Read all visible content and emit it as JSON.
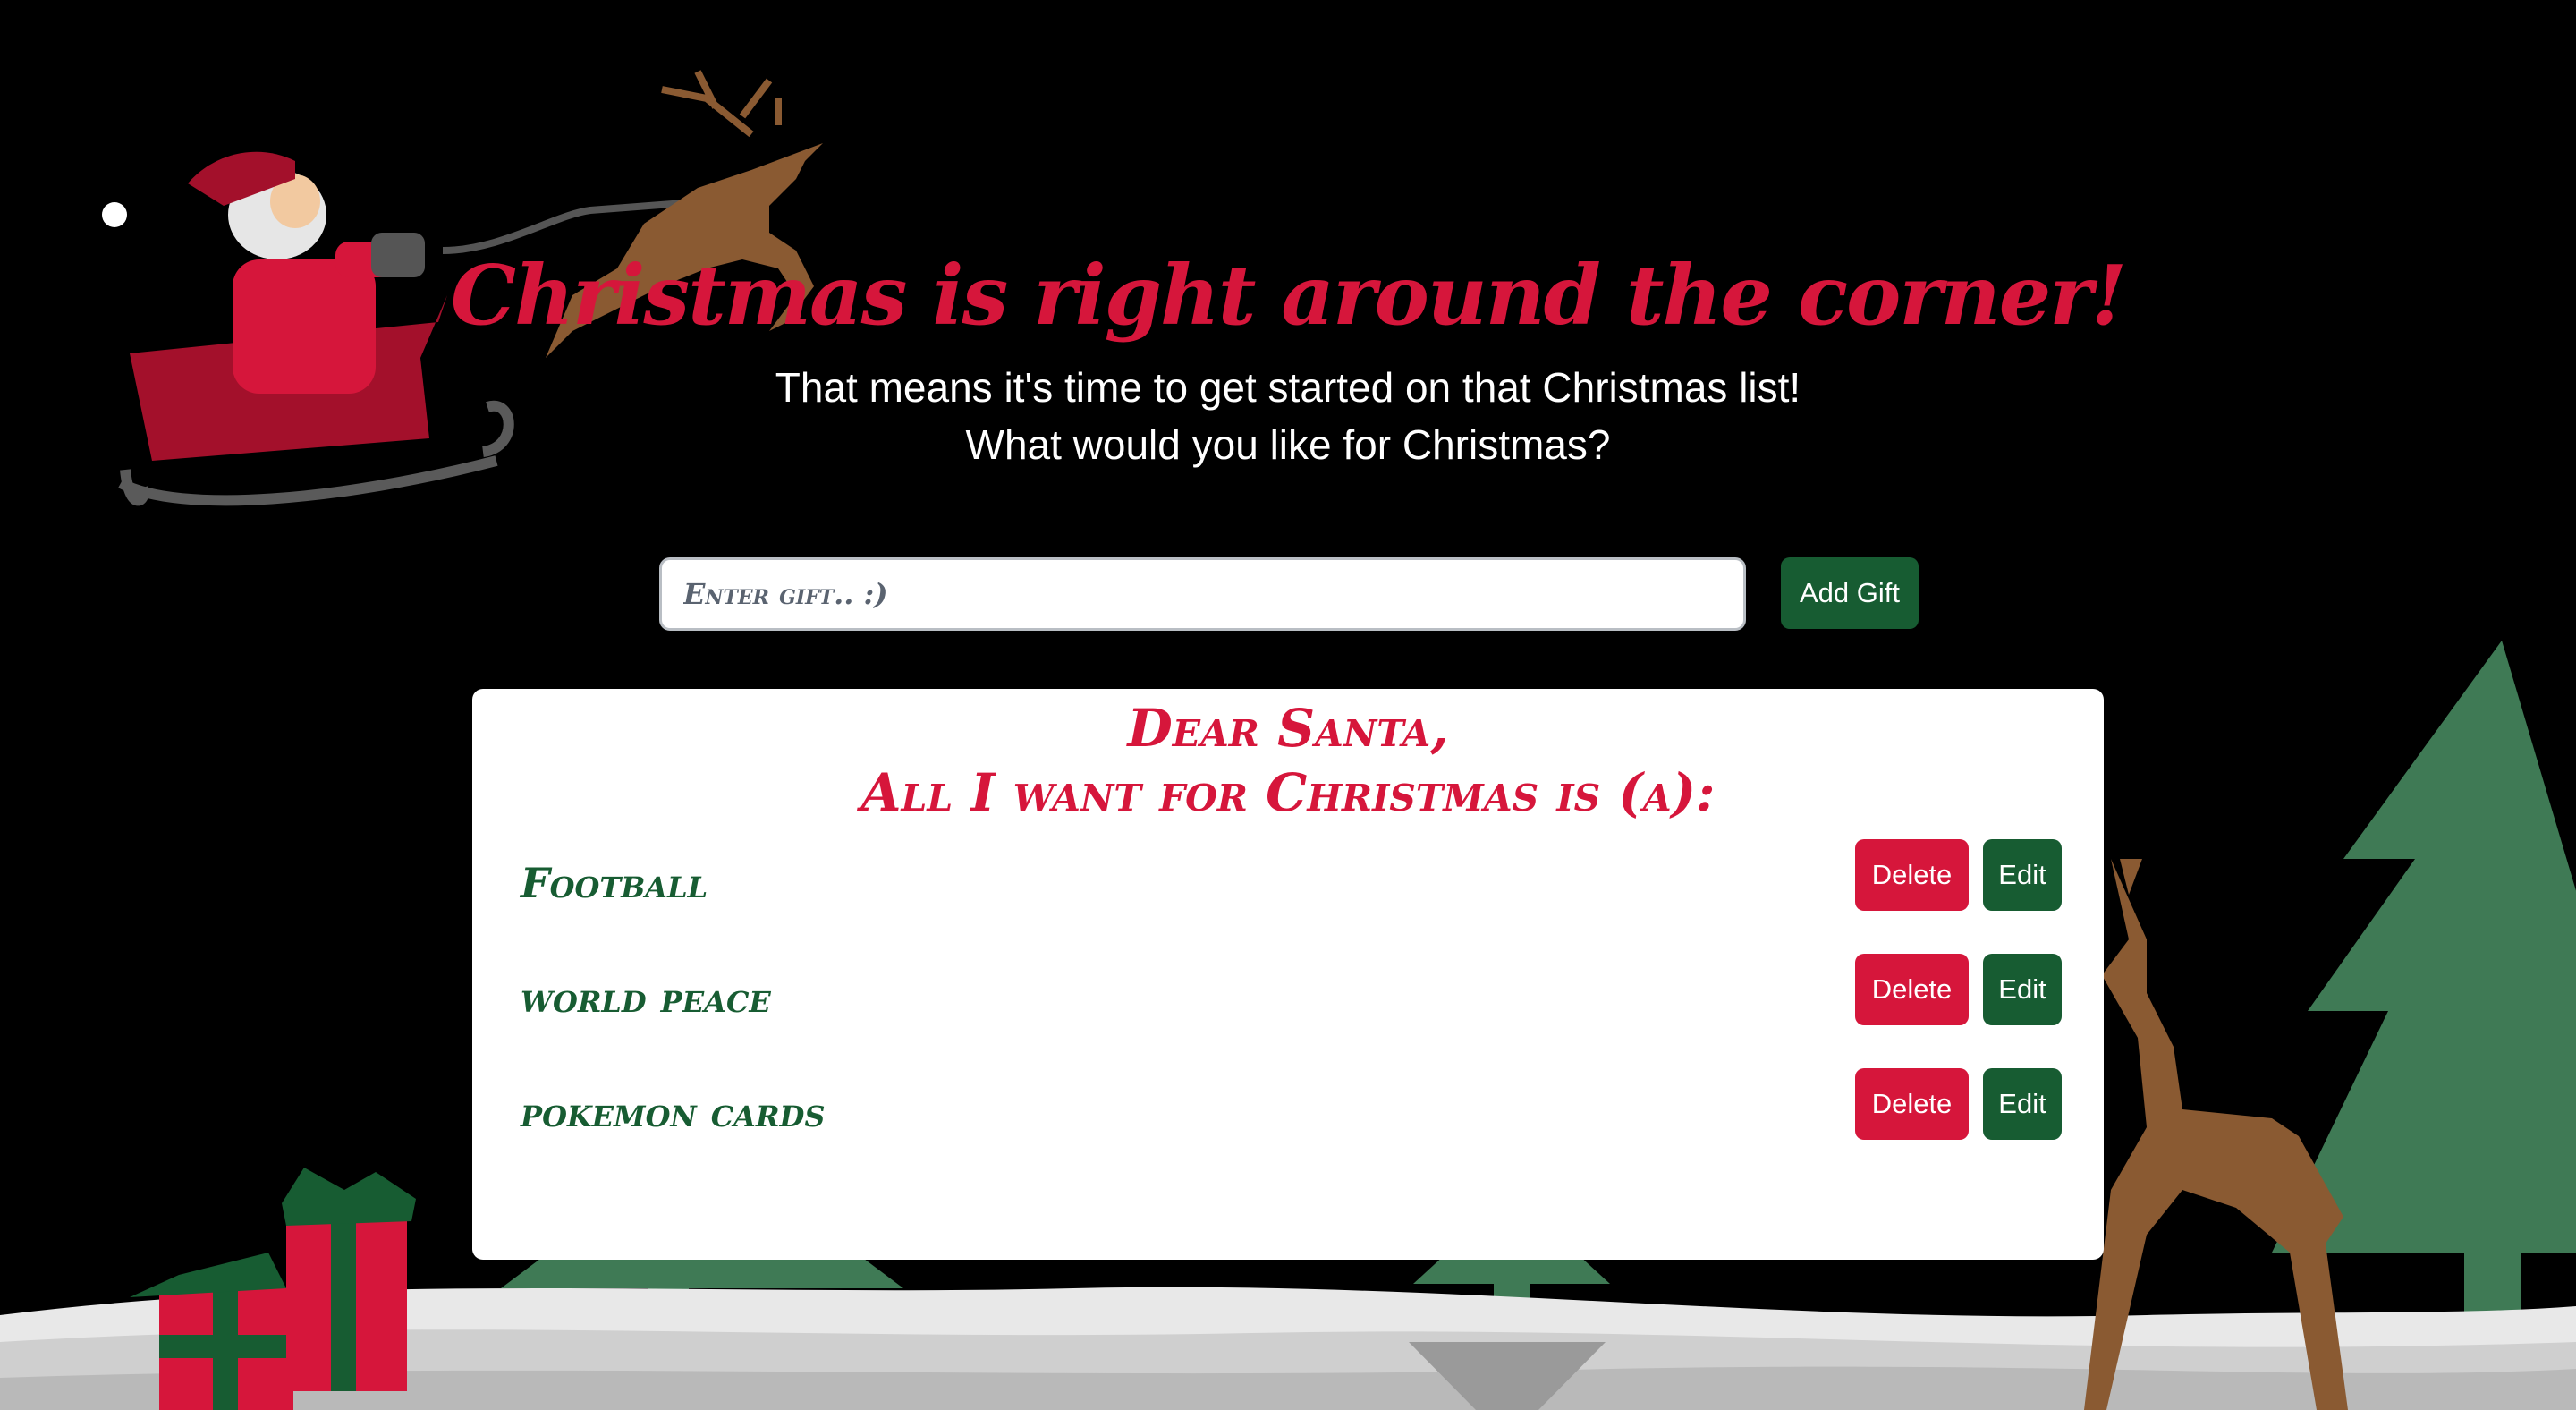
{
  "header": {
    "title": "Christmas is right around the corner!",
    "subtitle_line1": "That means it's time to get started on that Christmas list!",
    "subtitle_line2": "What would you like for Christmas?"
  },
  "form": {
    "placeholder": "Enter gift.. :)",
    "value": "",
    "add_label": "Add Gift"
  },
  "letter": {
    "greeting_line1": "Dear Santa,",
    "greeting_line2": "All I want for Christmas is (a):",
    "gifts": [
      {
        "name": "Football",
        "delete_label": "Delete",
        "edit_label": "Edit"
      },
      {
        "name": "world peace",
        "delete_label": "Delete",
        "edit_label": "Edit"
      },
      {
        "name": "pokemon cards",
        "delete_label": "Delete",
        "edit_label": "Edit"
      }
    ]
  },
  "colors": {
    "background": "#000000",
    "accent_red": "#d6163b",
    "accent_green": "#175c32",
    "tree_green": "#3f7a55",
    "reindeer_brown": "#8a5a32",
    "snow": "#d9d9d9"
  },
  "icons": [
    "santa-sleigh-illustration",
    "flying-reindeer-illustration",
    "christmas-tree-icon",
    "gift-box-icon",
    "standing-reindeer-illustration",
    "snow-ground"
  ]
}
